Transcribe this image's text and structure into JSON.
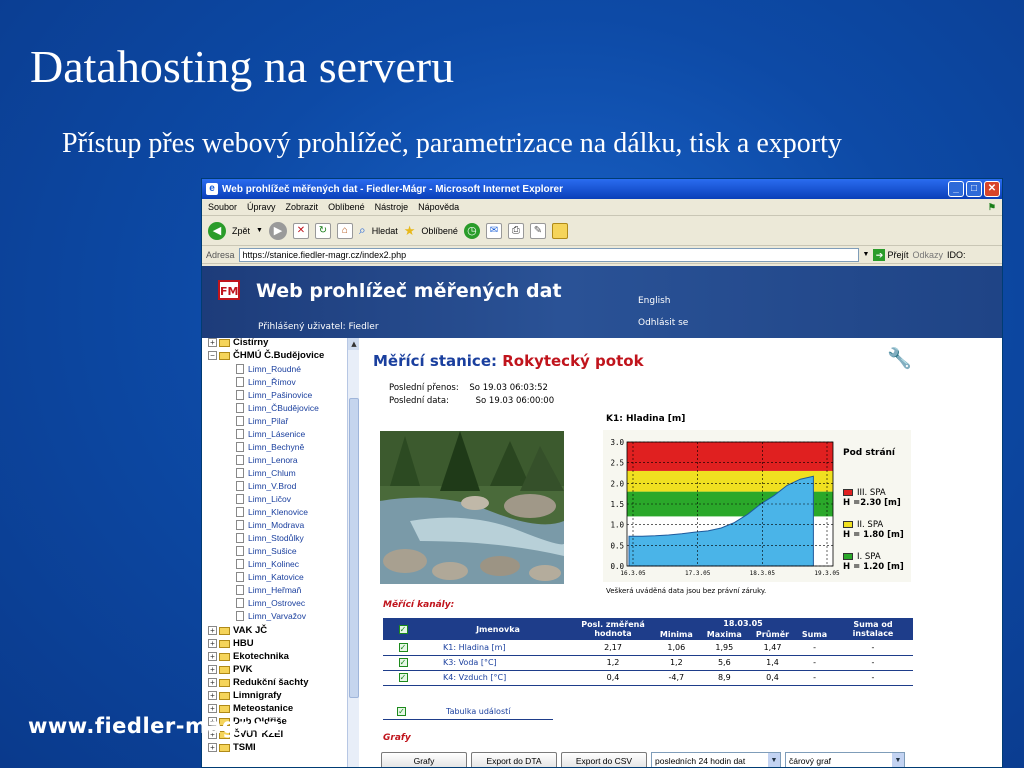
{
  "slide": {
    "title": "Datahosting na serveru",
    "subtitle": "Přístup přes webový prohlížeč, parametrizace na dálku, tisk a exporty",
    "footer": "www.fiedler-magr.cz"
  },
  "browser": {
    "window_title": "Web prohlížeč měřených dat - Fiedler-Mágr - Microsoft Internet Explorer",
    "menu": [
      "Soubor",
      "Úpravy",
      "Zobrazit",
      "Oblíbené",
      "Nástroje",
      "Nápověda"
    ],
    "toolbar": {
      "back": "Zpět",
      "search": "Hledat",
      "favorites": "Oblíbené"
    },
    "address_label": "Adresa",
    "address": "https://stanice.fiedler-magr.cz/index2.php",
    "go": "Přejít",
    "links": "Odkazy",
    "extra": "IDO:"
  },
  "header": {
    "logo": "FM",
    "title": "Web prohlížeč měřených dat",
    "user": "Přihlášený uživatel: Fiedler",
    "lang": "English",
    "logout": "Odhlásit se"
  },
  "tree": {
    "top": "Čistírny",
    "expanded": "ČHMÚ Č.Budějovice",
    "leaves": [
      "Limn_Roudné",
      "Limn_Římov",
      "Limn_Pašinovice",
      "Limn_ČBudějovice",
      "Limn_Pilař",
      "Limn_Lásenice",
      "Limn_Bechyně",
      "Limn_Lenora",
      "Limn_Chlum",
      "Limn_V.Brod",
      "Limn_Ličov",
      "Limn_Klenovice",
      "Limn_Modrava",
      "Limn_Stodůlky",
      "Limn_Sušice",
      "Limn_Kolinec",
      "Limn_Katovice",
      "Limn_Heřmaň",
      "Limn_Ostrovec",
      "Limn_Varvažov"
    ],
    "nodes": [
      "VAK JČ",
      "HBU",
      "Ekotechnika",
      "PVK",
      "Redukční šachty",
      "Limnigrafy",
      "Meteostanice",
      "Dub Oldřiše",
      "ČVUT KZEI",
      "TSMI"
    ]
  },
  "station": {
    "label": "Měřící stanice:",
    "name": "Rokytecký potok",
    "last_transfer_label": "Poslední přenos:",
    "last_transfer": "So 19.03 06:03:52",
    "last_data_label": "Poslední data:",
    "last_data": "So 19.03 06:00:00"
  },
  "chart_data": {
    "type": "area",
    "title": "K1: Hladina [m]",
    "x": [
      "16.3.05",
      "17.3.05",
      "18.3.05",
      "19.3.05"
    ],
    "ylim": [
      0,
      3.0
    ],
    "yticks": [
      0.0,
      0.5,
      1.0,
      1.5,
      2.0,
      2.5,
      3.0
    ],
    "series": [
      {
        "name": "",
        "values": [
          0.72,
          0.72,
          0.73,
          0.75,
          0.78,
          0.82,
          0.85,
          0.92,
          1.05,
          1.25,
          1.5,
          1.7,
          1.95,
          2.1,
          2.17
        ]
      }
    ],
    "bands": [
      {
        "from": 0,
        "to": 1.2,
        "color": "#ffffff"
      },
      {
        "from": 1.2,
        "to": 1.8,
        "color": "#2aa82a"
      },
      {
        "from": 1.8,
        "to": 2.3,
        "color": "#f0e020"
      },
      {
        "from": 2.3,
        "to": 3.0,
        "color": "#e02020"
      }
    ],
    "legend_title": "Pod strání",
    "legend": [
      {
        "name": "III. SPA",
        "value": "H =2.30 [m]",
        "color": "#e02020"
      },
      {
        "name": "II. SPA",
        "value": "H = 1.80 [m]",
        "color": "#f0e020"
      },
      {
        "name": "I. SPA",
        "value": "H = 1.20 [m]",
        "color": "#2aa82a"
      }
    ],
    "note": "Veškerá uváděná data jsou bez právní záruky.",
    "fill_color": "#4ab4e8",
    "grid": true
  },
  "channels": {
    "label": "Měřící kanály:",
    "headers": {
      "name": "Jmenovka",
      "last": "Posl. změřená hodnota",
      "date": "18.03.05",
      "min": "Minima",
      "max": "Maxima",
      "avg": "Průměr",
      "sum": "Suma",
      "since": "Suma od instalace"
    },
    "rows": [
      {
        "name": "K1: Hladina [m]",
        "last": "2,17",
        "min": "1,06",
        "max": "1,95",
        "avg": "1,47",
        "sum": "-",
        "since": "-"
      },
      {
        "name": "K3: Voda [°C]",
        "last": "1,2",
        "min": "1,2",
        "max": "5,6",
        "avg": "1,4",
        "sum": "-",
        "since": "-"
      },
      {
        "name": "K4: Vzduch [°C]",
        "last": "0,4",
        "min": "-4,7",
        "max": "8,9",
        "avg": "0,4",
        "sum": "-",
        "since": "-"
      }
    ],
    "events": "Tabulka událostí"
  },
  "graphs": {
    "label": "Grafy",
    "btn_graphs": "Grafy",
    "btn_dta": "Export do DTA",
    "btn_csv": "Export do CSV",
    "period": "posledních 24 hodin dat",
    "style": "čárový graf"
  }
}
